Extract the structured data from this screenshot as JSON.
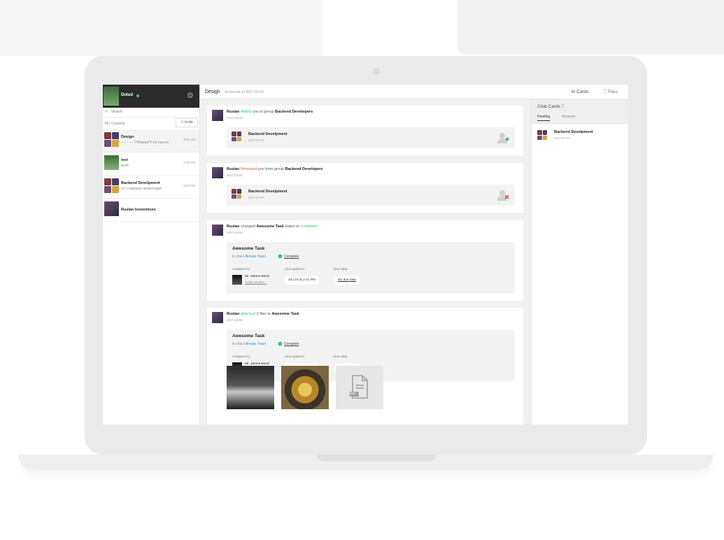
{
  "user": {
    "name": "Dolud"
  },
  "sidebar": {
    "search_label": "Search",
    "contacts_count": "342 Contacts",
    "invite_label": "Invite",
    "conversations": [
      {
        "title": "Design",
        "preview": "- - - - - - -!!!Важно!!!! не писать",
        "time": "8:01 AM"
      },
      {
        "title": "test",
        "preview": "test4",
        "time": "4:08 PM"
      },
      {
        "title": "Backend Develpment",
        "preview": "тут странное происходит",
        "time": "9:00 PM"
      },
      {
        "title": "Ruslan Inozemtsev",
        "preview": "",
        "time": ""
      }
    ]
  },
  "header": {
    "title": "Design",
    "subtitle": "Archieved on 2017.03.03",
    "cards_label": "Cards",
    "files_label": "Files"
  },
  "feed": {
    "item1": {
      "actor": "Ruslan",
      "verb": "Added",
      "mid": "you to group",
      "target": "Backend Developers",
      "date": "2017.03.03",
      "group_title": "Backend Develpment",
      "group_date": "2017.07.07"
    },
    "item2": {
      "actor": "Ruslan",
      "verb": "Removed",
      "mid": "you from group",
      "target": "Backend Developers",
      "date": "2017.03.03",
      "group_title": "Backend Develpment",
      "group_date": "2017.07.07"
    },
    "item3": {
      "actor": "Ruslan",
      "pre": "changed",
      "task": "Awesome Task",
      "mid": "status to",
      "status": "Complete",
      "date": "2017.03.03"
    },
    "item4": {
      "actor": "Ruslan",
      "verb": "attached",
      "mid": "2 files to",
      "task": "Awesome Task",
      "date": "2017.03.03"
    },
    "task_card": {
      "title": "Awesome Task",
      "in_chat_prefix": "in chat",
      "chat_name": "Ultimate Team",
      "status": "Complete",
      "assigned_label": "Assigned to",
      "assignee": "Mr. James Bond",
      "assign_link": "Assign another...",
      "last_updated_label": "Last updated",
      "last_updated": "Jun 24 at 2:41 PM",
      "due_label": "Due date",
      "due": "No due date"
    },
    "file_icon": "document-icon",
    "file_ext": "PDF"
  },
  "right_panel": {
    "title": "Chat Cards",
    "count": "7",
    "tab_pending": "Pending",
    "tab_archive": "Archieve",
    "item_title": "Backend Develpment",
    "item_date": "2017.07.07"
  }
}
